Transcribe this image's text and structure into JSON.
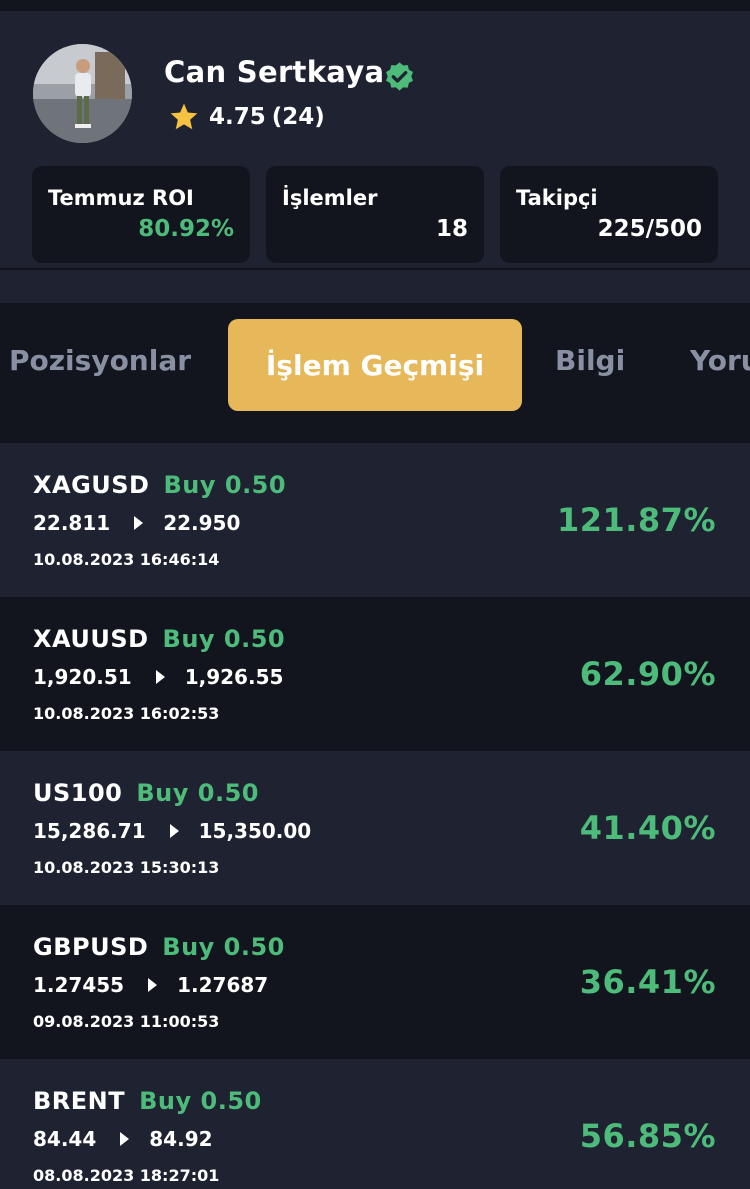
{
  "profile": {
    "name": "Can Sertkaya",
    "rating": "4.75",
    "rating_count": "(24)",
    "stats": [
      {
        "label": "Temmuz ROI",
        "value": "80.92%"
      },
      {
        "label": "İşlemler",
        "value": "18"
      },
      {
        "label": "Takipçi",
        "value": "225/500"
      }
    ]
  },
  "tabs": [
    "Pozisyonlar",
    "İşlem Geçmişi",
    "Bilgi",
    "Yorumlar"
  ],
  "active_tab": "İşlem Geçmişi",
  "trades": [
    {
      "symbol": "XAGUSD",
      "side": "Buy 0.50",
      "open": "22.811",
      "close": "22.950",
      "time": "10.08.2023 16:46:14",
      "roi": "121.87%"
    },
    {
      "symbol": "XAUUSD",
      "side": "Buy 0.50",
      "open": "1,920.51",
      "close": "1,926.55",
      "time": "10.08.2023 16:02:53",
      "roi": "62.90%"
    },
    {
      "symbol": "US100",
      "side": "Buy 0.50",
      "open": "15,286.71",
      "close": "15,350.00",
      "time": "10.08.2023 15:30:13",
      "roi": "41.40%"
    },
    {
      "symbol": "GBPUSD",
      "side": "Buy 0.50",
      "open": "1.27455",
      "close": "1.27687",
      "time": "09.08.2023 11:00:53",
      "roi": "36.41%"
    },
    {
      "symbol": "BRENT",
      "side": "Buy 0.50",
      "open": "84.44",
      "close": "84.92",
      "time": "08.08.2023 18:27:01",
      "roi": "56.85%"
    }
  ],
  "colors": {
    "accent": "#e6b85a",
    "positive": "#4dbb7a",
    "verified": "#4dbb7a",
    "star": "#f5c242"
  },
  "icons": {
    "verified": "verified-badge-icon",
    "star": "star-icon",
    "arrow": "play-arrow-icon"
  }
}
